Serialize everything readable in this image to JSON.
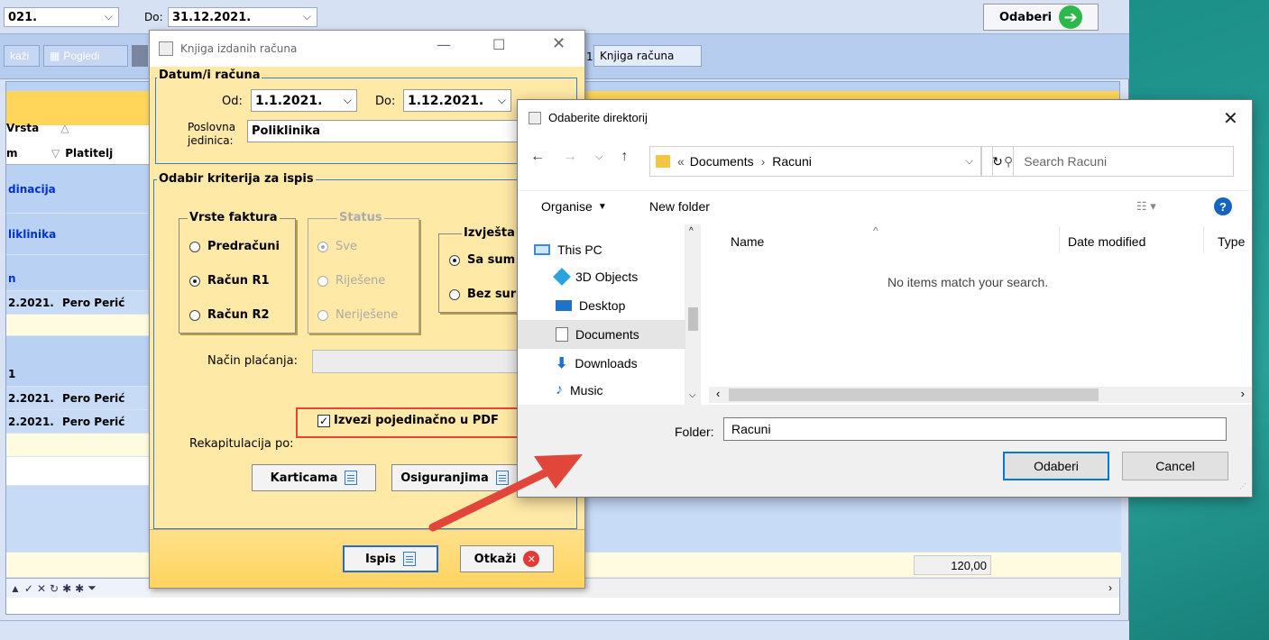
{
  "bg": {
    "date_from": "021.",
    "to_label": "Do:",
    "date_to": "31.12.2021.",
    "select_button": "Odaberi",
    "toolbar_prikazi": "kaži",
    "toolbar_pogledi": "Pogledi",
    "toolbar_num": "1",
    "toolbar_knjiga": "Knjiga računa",
    "col_vrsta": "Vrsta",
    "col_m": "m",
    "col_platitelj": "Platitelj",
    "rows": [
      {
        "date": "dinacija",
        "name": ""
      },
      {
        "date": "liklinika",
        "name": ""
      },
      {
        "date": "n",
        "name": ""
      },
      {
        "date": "2.2021.",
        "name": "Pero Perić"
      },
      {
        "date": "1",
        "name": ""
      },
      {
        "date": "2.2021.",
        "name": "Pero Perić"
      },
      {
        "date": "2.2021.",
        "name": "Pero Perić"
      }
    ],
    "total": "120,00"
  },
  "dlg1": {
    "title": "Knjiga izdanih računa",
    "grp_dates": "Datum/i računa",
    "od_label": "Od:",
    "od_value": "1.1.2021.",
    "do_label": "Do:",
    "do_value": "1.12.2021.",
    "unit_label_1": "Poslovna",
    "unit_label_2": "jedinica:",
    "unit_value": "Poliklinika",
    "grp_criteria": "Odabir kriterija za ispis",
    "grp_types": "Vrste faktura",
    "type_options": [
      "Predračuni",
      "Račun R1",
      "Račun R2"
    ],
    "selected_type": "Račun R1",
    "grp_status": "Status",
    "status_options": [
      "Sve",
      "Riješene",
      "Neriješene"
    ],
    "grp_report": "Izvješta",
    "report_options": [
      "Sa sum",
      "Bez sur"
    ],
    "payment_label": "Način plaćanja:",
    "export_label": "Izvezi pojedinačno u PDF",
    "recap_label": "Rekapitulacija po:",
    "btn_cards": "Karticama",
    "btn_insurance": "Osiguranjima",
    "btn_print": "Ispis",
    "btn_cancel": "Otkaži"
  },
  "dlg2": {
    "title": "Odaberite direktorij",
    "path": [
      "Documents",
      "Racuni"
    ],
    "search_placeholder": "Search Racuni",
    "organise": "Organise",
    "new_folder": "New folder",
    "nav_items": [
      {
        "label": "This PC",
        "icon": "pc-icon"
      },
      {
        "label": "3D Objects",
        "icon": "cube-icon"
      },
      {
        "label": "Desktop",
        "icon": "desktop-icon"
      },
      {
        "label": "Documents",
        "icon": "documents-icon"
      },
      {
        "label": "Downloads",
        "icon": "download-icon"
      },
      {
        "label": "Music",
        "icon": "music-icon"
      }
    ],
    "col_name": "Name",
    "col_date": "Date modified",
    "col_type": "Type",
    "empty_message": "No items match your search.",
    "folder_label": "Folder:",
    "folder_value": "Racuni",
    "btn_select": "Odaberi",
    "btn_cancel": "Cancel"
  },
  "colors": {
    "arrow": "#e2463a",
    "highlight": "#e2463a",
    "accent": "#0078d7"
  }
}
